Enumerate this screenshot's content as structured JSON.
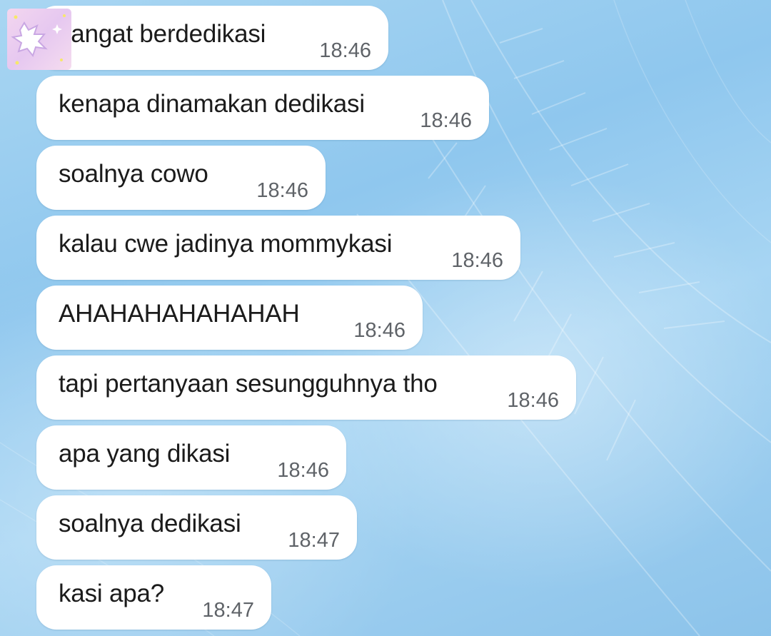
{
  "chat": {
    "messages": [
      {
        "text": "sangat berdedikasi",
        "time": "18:46"
      },
      {
        "text": "kenapa dinamakan dedikasi",
        "time": "18:46"
      },
      {
        "text": "soalnya cowo",
        "time": "18:46"
      },
      {
        "text": "kalau cwe jadinya mommykasi",
        "time": "18:46"
      },
      {
        "text": "AHAHAHAHAHAHAH",
        "time": "18:46"
      },
      {
        "text": "tapi pertanyaan sesungguhnya tho",
        "time": "18:46"
      },
      {
        "text": "apa yang dikasi",
        "time": "18:46"
      },
      {
        "text": "soalnya dedikasi",
        "time": "18:47"
      },
      {
        "text": "kasi apa?",
        "time": "18:47"
      }
    ]
  },
  "colors": {
    "bubble": "#ffffff",
    "message_text": "#1b1b1b",
    "timestamp_text": "#5f6368",
    "background": "#a9d6f2"
  },
  "icons": {
    "sticker": "sticker-icon"
  }
}
